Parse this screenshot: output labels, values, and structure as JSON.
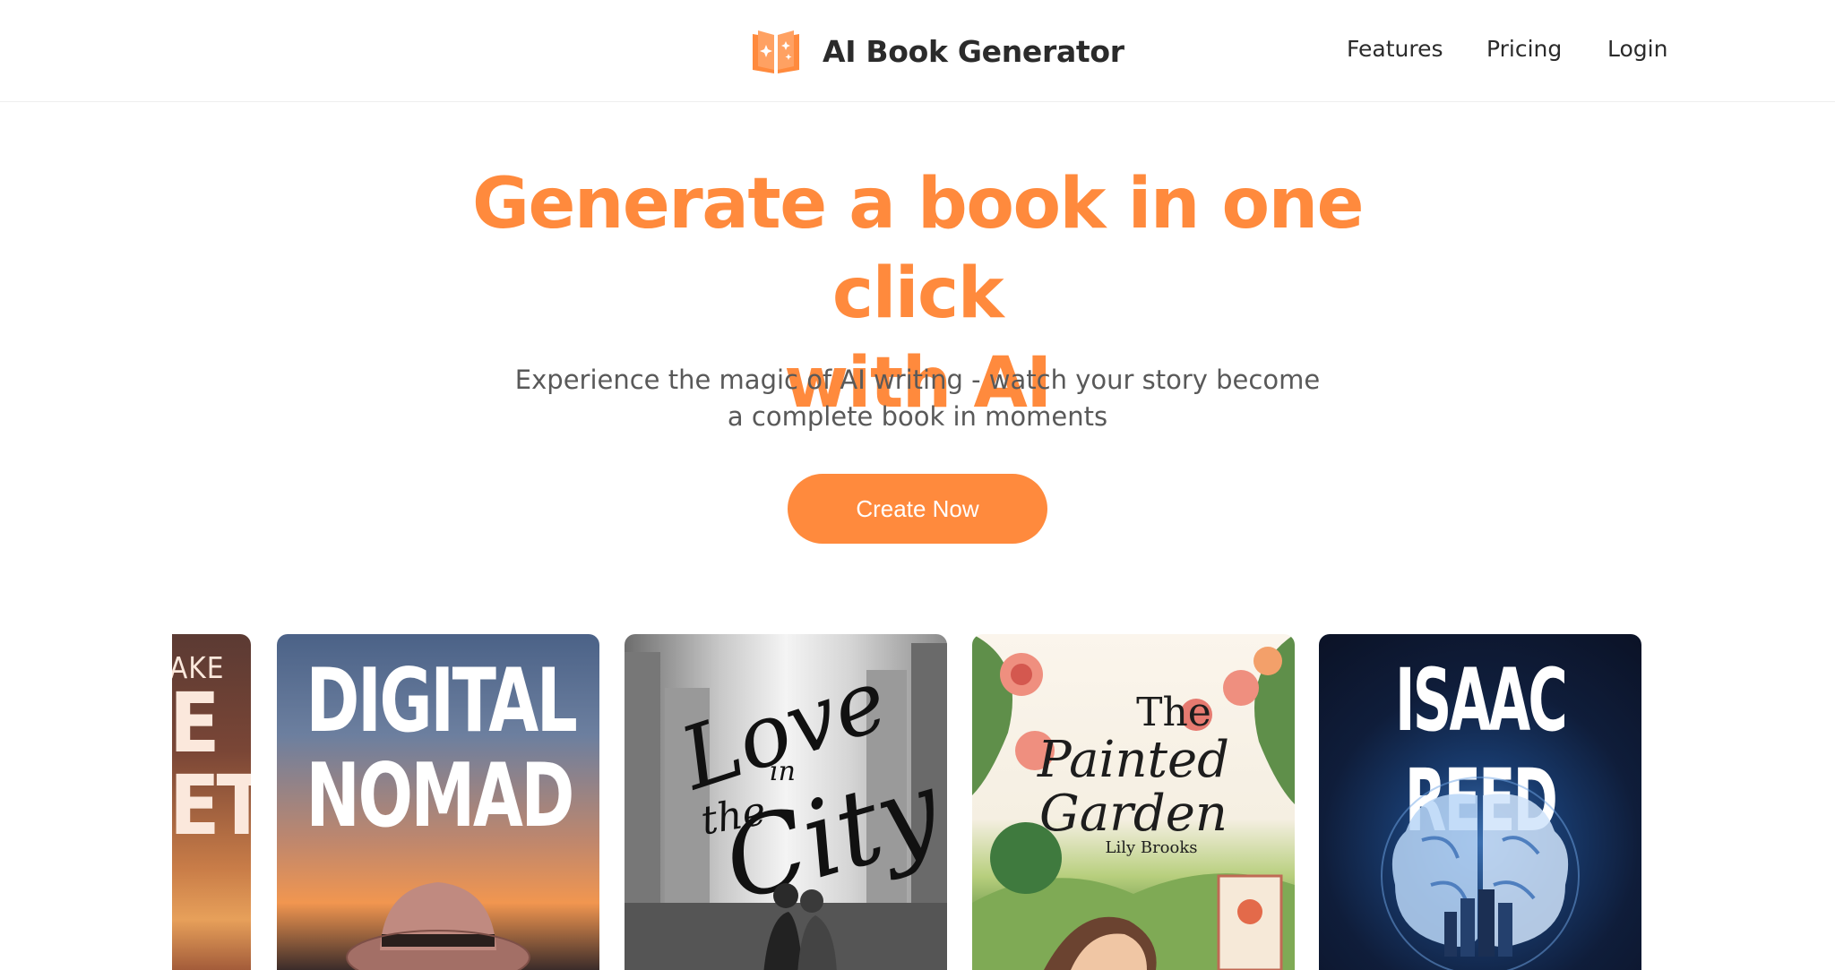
{
  "header": {
    "brand_name": "AI Book Generator",
    "nav": {
      "features": "Features",
      "pricing": "Pricing",
      "login": "Login"
    }
  },
  "hero": {
    "title_line1": "Generate a book in one click",
    "title_line2": "with AI",
    "subtitle_line1": "Experience the magic of AI writing - watch your story become",
    "subtitle_line2": "a complete book in moments",
    "cta": "Create Now"
  },
  "covers": [
    {
      "line1": "AKE",
      "line2": "E",
      "line3": "ET"
    },
    {
      "title_line1": "DIGITAL",
      "title_line2": "NOMAD"
    },
    {
      "w1": "Love",
      "w2": "in",
      "w3": "the",
      "w4": "City"
    },
    {
      "w1": "The",
      "w2": "Painted",
      "w3": "Garden",
      "author": "Lily Brooks"
    },
    {
      "title": "ISAAC REED"
    }
  ],
  "colors": {
    "accent": "#ff8a3d",
    "text": "#2b2b2b",
    "muted": "#595959"
  },
  "icons": {
    "brand": "open-book-sparkle-icon"
  }
}
